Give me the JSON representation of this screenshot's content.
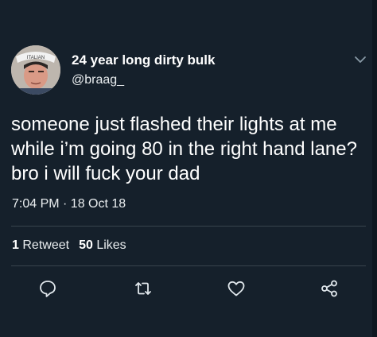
{
  "user": {
    "display_name": "24 year long dirty bulk",
    "handle": "@braag_",
    "avatar_label": "ITALIAN"
  },
  "tweet": {
    "text": "someone just flashed their lights at me while i’m going 80 in the right hand lane? bro i will fuck your dad",
    "timestamp": "7:04 PM · 18 Oct 18"
  },
  "stats": {
    "retweets_count": "1",
    "retweets_label": "Retweet",
    "likes_count": "50",
    "likes_label": "Likes"
  },
  "actions": [
    "reply-icon",
    "retweet-icon",
    "like-icon",
    "share-icon"
  ],
  "colors": {
    "background": "#15202b",
    "divider": "#38444d",
    "icon": "#e1e8ed"
  }
}
